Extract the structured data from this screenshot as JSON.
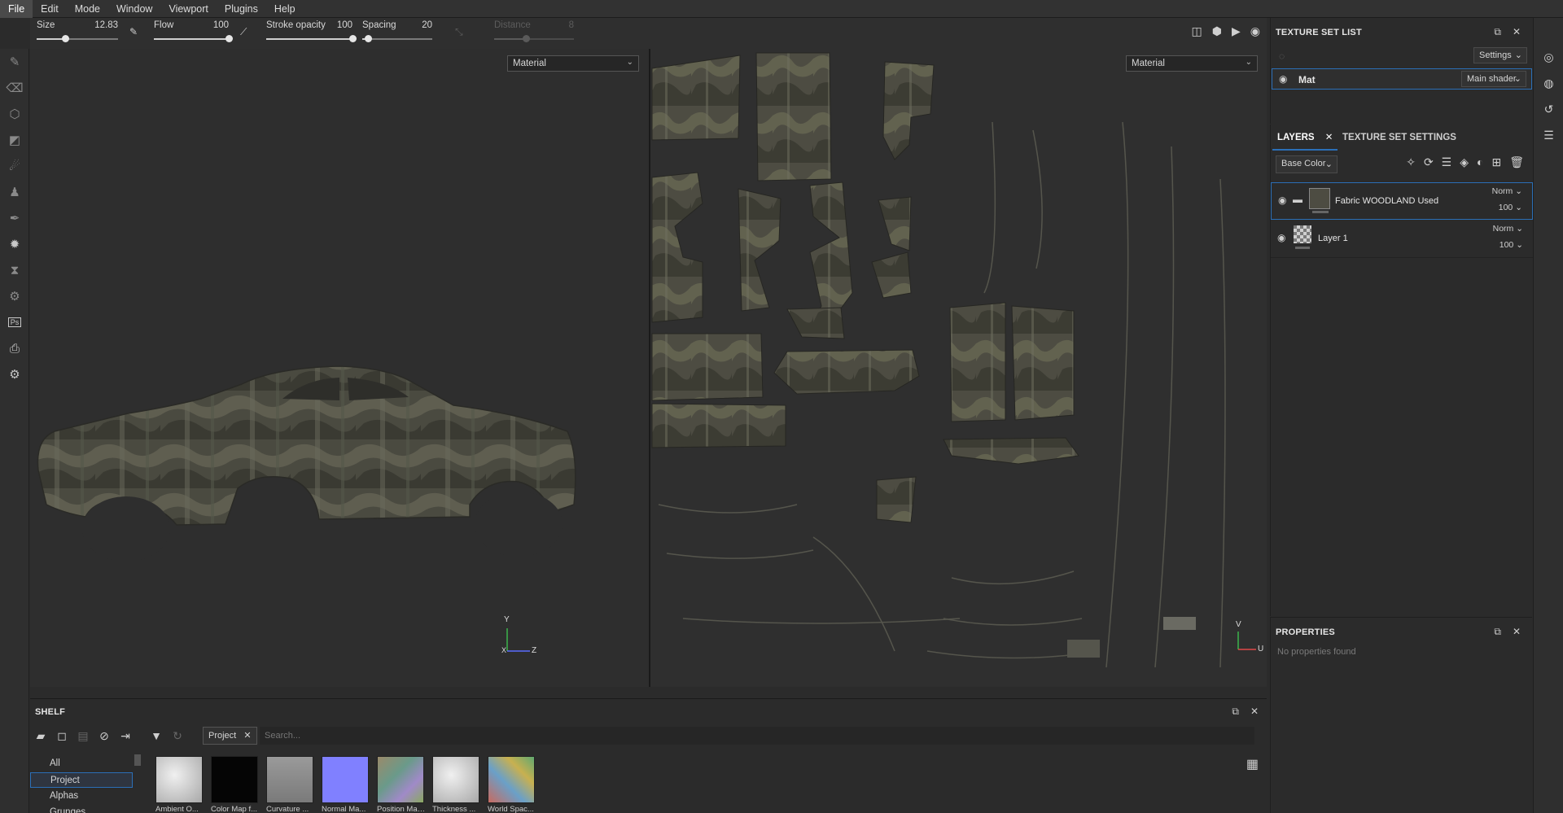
{
  "menu": [
    "File",
    "Edit",
    "Mode",
    "Window",
    "Viewport",
    "Plugins",
    "Help"
  ],
  "tool_params": {
    "size": {
      "label": "Size",
      "value": "12.83",
      "level": 0.35
    },
    "flow": {
      "label": "Flow",
      "value": "100",
      "level": 1.0
    },
    "stroke_opacity": {
      "label": "Stroke opacity",
      "value": "100",
      "level": 1.0
    },
    "spacing": {
      "label": "Spacing",
      "value": "20",
      "level": 0.08
    },
    "distance": {
      "label": "Distance",
      "value": "8",
      "level": 0.4
    }
  },
  "viewport3d": {
    "mode": "Material",
    "axes": {
      "y": "Y",
      "x": "X",
      "z": "Z"
    }
  },
  "viewport2d": {
    "mode": "Material",
    "axes": {
      "v": "V",
      "u": "U"
    }
  },
  "texture_set_list": {
    "title": "TEXTURE SET LIST",
    "settings_label": "Settings",
    "items": [
      {
        "name": "Mat",
        "shader": "Main shader"
      }
    ]
  },
  "layers": {
    "tabs": [
      "LAYERS",
      "TEXTURE SET SETTINGS"
    ],
    "channel": "Base Color",
    "items": [
      {
        "name": "Fabric WOODLAND Used",
        "blend": "Norm",
        "opacity": "100"
      },
      {
        "name": "Layer 1",
        "blend": "Norm",
        "opacity": "100"
      }
    ]
  },
  "properties": {
    "title": "PROPERTIES",
    "empty_text": "No properties found"
  },
  "shelf": {
    "title": "SHELF",
    "filter_tag": "Project",
    "search_placeholder": "Search...",
    "categories": [
      "All",
      "Project",
      "Alphas",
      "Grunges"
    ],
    "thumbnails": [
      {
        "label": "Ambient O...",
        "color": "#d4d4d4"
      },
      {
        "label": "Color Map f...",
        "color": "#050505"
      },
      {
        "label": "Curvature ...",
        "color": "#8a8a8a"
      },
      {
        "label": "Normal Ma...",
        "color": "#8080ff"
      },
      {
        "label": "Position Mat...",
        "color": "#8a8a6a"
      },
      {
        "label": "Thickness ...",
        "color": "#c8c8c8"
      },
      {
        "label": "World Spac...",
        "color": "#7aa060"
      }
    ]
  },
  "colors": {
    "accent": "#2b6fb7",
    "camo_dark": "#3a3a30",
    "camo_mid": "#5e5d4f",
    "camo_light": "#7c7c70"
  }
}
